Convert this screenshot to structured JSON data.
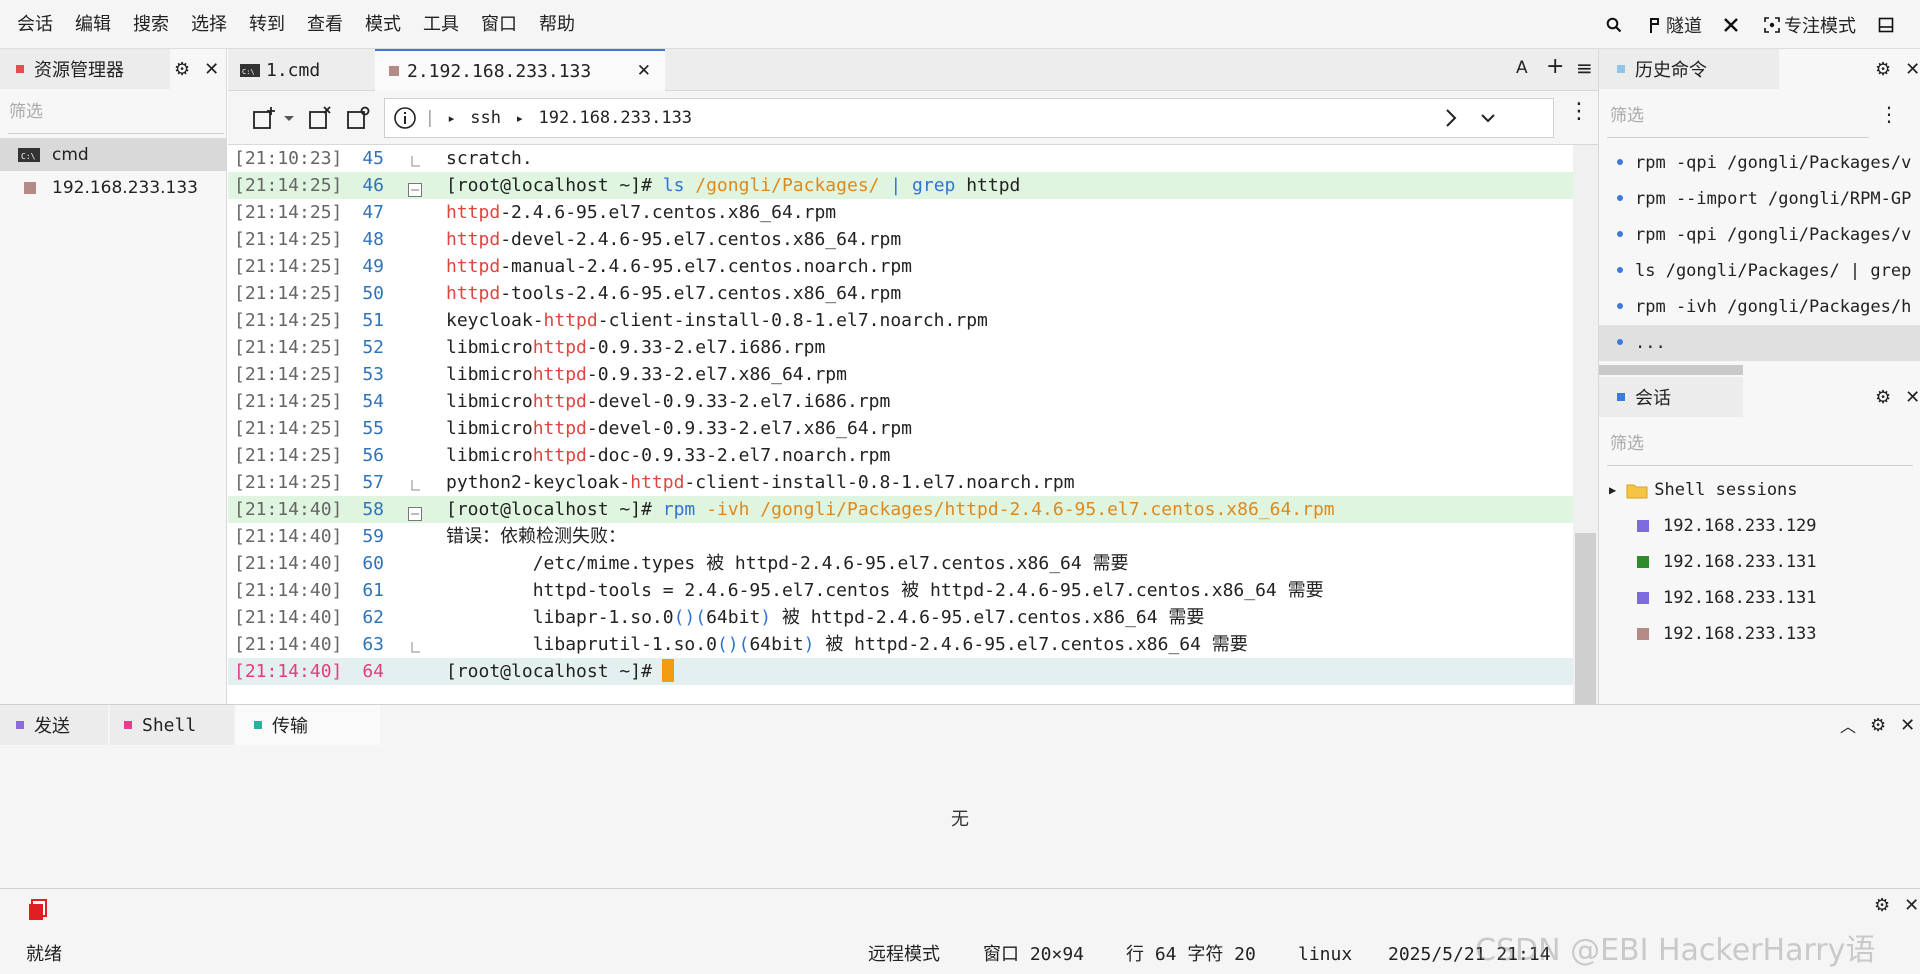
{
  "menu": [
    "会话",
    "编辑",
    "搜索",
    "选择",
    "转到",
    "查看",
    "模式",
    "工具",
    "窗口",
    "帮助"
  ],
  "menu_right": {
    "tunnel": "隧道",
    "focus": "专注模式"
  },
  "explorer": {
    "title": "资源管理器",
    "filter_placeholder": "筛选",
    "items": [
      {
        "label": "cmd",
        "color": "#333333"
      },
      {
        "label": "192.168.233.133",
        "color": "#b48a86"
      }
    ]
  },
  "tabs": [
    {
      "label": "1.cmd"
    },
    {
      "label": "2.192.168.233.133",
      "color": "#b48a86"
    }
  ],
  "tab_tools": {
    "font": "A",
    "add": "+",
    "menu": "≡"
  },
  "address": {
    "proto": "ssh",
    "host": "192.168.233.133"
  },
  "terminal": {
    "lines": [
      {
        "ts": "[21:10:23]",
        "n": "45",
        "text": "scratch."
      },
      {
        "ts": "[21:14:25]",
        "n": "46",
        "prompt": "[root@localhost ~]#",
        "cmd": " ls",
        "path": " /gongli/Packages/",
        "pipe": " | ",
        "grep": "grep",
        "rest": " httpd"
      },
      {
        "ts": "[21:14:25]",
        "n": "47",
        "pre": "",
        "hl": "httpd",
        "post": "-2.4.6-95.el7.centos.x86_64.rpm"
      },
      {
        "ts": "[21:14:25]",
        "n": "48",
        "pre": "",
        "hl": "httpd",
        "post": "-devel-2.4.6-95.el7.centos.x86_64.rpm"
      },
      {
        "ts": "[21:14:25]",
        "n": "49",
        "pre": "",
        "hl": "httpd",
        "post": "-manual-2.4.6-95.el7.centos.noarch.rpm"
      },
      {
        "ts": "[21:14:25]",
        "n": "50",
        "pre": "",
        "hl": "httpd",
        "post": "-tools-2.4.6-95.el7.centos.x86_64.rpm"
      },
      {
        "ts": "[21:14:25]",
        "n": "51",
        "pre": "keycloak-",
        "hl": "httpd",
        "post": "-client-install-0.8-1.el7.noarch.rpm"
      },
      {
        "ts": "[21:14:25]",
        "n": "52",
        "pre": "libmicro",
        "hl": "httpd",
        "post": "-0.9.33-2.el7.i686.rpm"
      },
      {
        "ts": "[21:14:25]",
        "n": "53",
        "pre": "libmicro",
        "hl": "httpd",
        "post": "-0.9.33-2.el7.x86_64.rpm"
      },
      {
        "ts": "[21:14:25]",
        "n": "54",
        "pre": "libmicro",
        "hl": "httpd",
        "post": "-devel-0.9.33-2.el7.i686.rpm"
      },
      {
        "ts": "[21:14:25]",
        "n": "55",
        "pre": "libmicro",
        "hl": "httpd",
        "post": "-devel-0.9.33-2.el7.x86_64.rpm"
      },
      {
        "ts": "[21:14:25]",
        "n": "56",
        "pre": "libmicro",
        "hl": "httpd",
        "post": "-doc-0.9.33-2.el7.noarch.rpm"
      },
      {
        "ts": "[21:14:25]",
        "n": "57",
        "pre": "python2-keycloak-",
        "hl": "httpd",
        "post": "-client-install-0.8-1.el7.noarch.rpm"
      },
      {
        "ts": "[21:14:40]",
        "n": "58",
        "prompt": "[root@localhost ~]#",
        "cmd": " rpm",
        "flag": " -ivh",
        "path": " /gongli/Packages/httpd-2.4.6-95.el7.centos.x86_64.rpm"
      },
      {
        "ts": "[21:14:40]",
        "n": "59",
        "plain": "错误：依赖检测失败："
      },
      {
        "ts": "[21:14:40]",
        "n": "60",
        "plain": "        /etc/mime.types 被 httpd-2.4.6-95.el7.centos.x86_64 需要"
      },
      {
        "ts": "[21:14:40]",
        "n": "61",
        "plain": "        httpd-tools = 2.4.6-95.el7.centos 被 httpd-2.4.6-95.el7.centos.x86_64 需要"
      },
      {
        "ts": "[21:14:40]",
        "n": "62",
        "lib": "        libapr-1.so.0",
        "paren": "()(",
        "bit": "64bit",
        ")": ")",
        "tail": " 被 httpd-2.4.6-95.el7.centos.x86_64 需要"
      },
      {
        "ts": "[21:14:40]",
        "n": "63",
        "lib": "        libaprutil-1.so.0",
        "paren": "()(",
        "bit": "64bit",
        ")": ")",
        "tail": " 被 httpd-2.4.6-95.el7.centos.x86_64 需要"
      },
      {
        "ts": "[21:14:40]",
        "n": "64",
        "prompt": "[root@localhost ~]#",
        "current": true
      }
    ]
  },
  "history": {
    "title": "历史命令",
    "filter_placeholder": "筛选",
    "items": [
      "rpm -qpi /gongli/Packages/v",
      "rpm --import /gongli/RPM-GP",
      "rpm -qpi /gongli/Packages/v",
      "ls /gongli/Packages/ | grep",
      "rpm -ivh /gongli/Packages/h",
      "..."
    ]
  },
  "sessions": {
    "title": "会话",
    "filter_placeholder": "筛选",
    "folder": "Shell sessions",
    "items": [
      {
        "label": "192.168.233.129",
        "color": "#7b6ae0"
      },
      {
        "label": "192.168.233.131",
        "color": "#2e8b2e"
      },
      {
        "label": "192.168.233.131",
        "color": "#7b6ae0"
      },
      {
        "label": "192.168.233.133",
        "color": "#b48a86"
      }
    ]
  },
  "bottom": {
    "tabs": [
      {
        "label": "发送",
        "color": "#8d6ad8"
      },
      {
        "label": "Shell",
        "color": "#e0408c"
      },
      {
        "label": "传输",
        "color": "#2ab0a0"
      }
    ],
    "empty": "无"
  },
  "status": {
    "ready": "就绪",
    "mode": "远程模式",
    "window": "窗口 20×94",
    "pos": "行 64 字符 20",
    "os": "linux",
    "datetime": "2025/5/21 21:14",
    "watermark": "CSDN @EBI HackerHarry语"
  }
}
